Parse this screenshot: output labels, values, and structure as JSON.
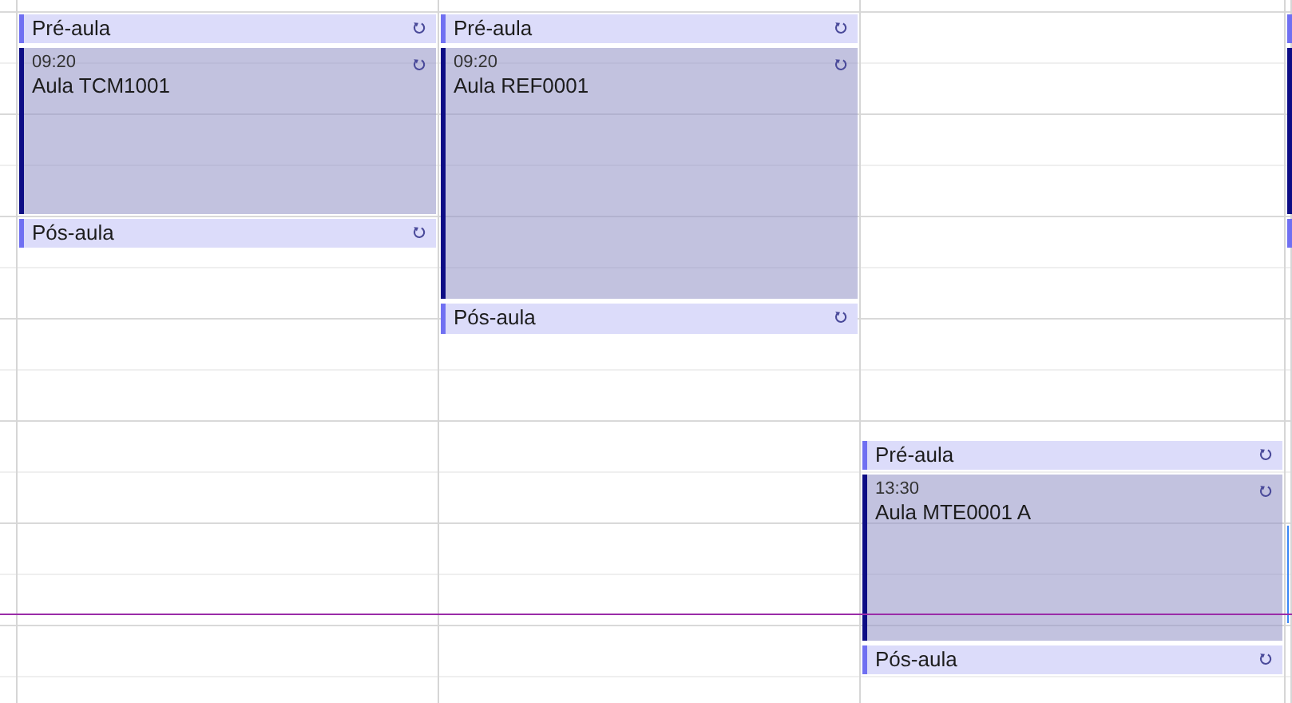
{
  "columns": [
    {
      "events": [
        {
          "kind": "pre",
          "title": "Pré-aula",
          "recurring": true
        },
        {
          "kind": "main",
          "time": "09:20",
          "title": "Aula TCM1001",
          "recurring": true
        },
        {
          "kind": "post",
          "title": "Pós-aula",
          "recurring": true
        }
      ]
    },
    {
      "events": [
        {
          "kind": "pre",
          "title": "Pré-aula",
          "recurring": true
        },
        {
          "kind": "main",
          "time": "09:20",
          "title": "Aula REF0001",
          "recurring": true
        },
        {
          "kind": "post",
          "title": "Pós-aula",
          "recurring": true
        }
      ]
    },
    {
      "events": [
        {
          "kind": "pre",
          "title": "Pré-aula",
          "recurring": true
        },
        {
          "kind": "main",
          "time": "13:30",
          "title": "Aula MTE0001 A",
          "recurring": true
        },
        {
          "kind": "post",
          "title": "Pós-aula",
          "recurring": true
        }
      ]
    },
    {
      "events": [
        {
          "kind": "pre"
        },
        {
          "kind": "main"
        },
        {
          "kind": "post"
        },
        {
          "kind": "other"
        }
      ]
    }
  ]
}
